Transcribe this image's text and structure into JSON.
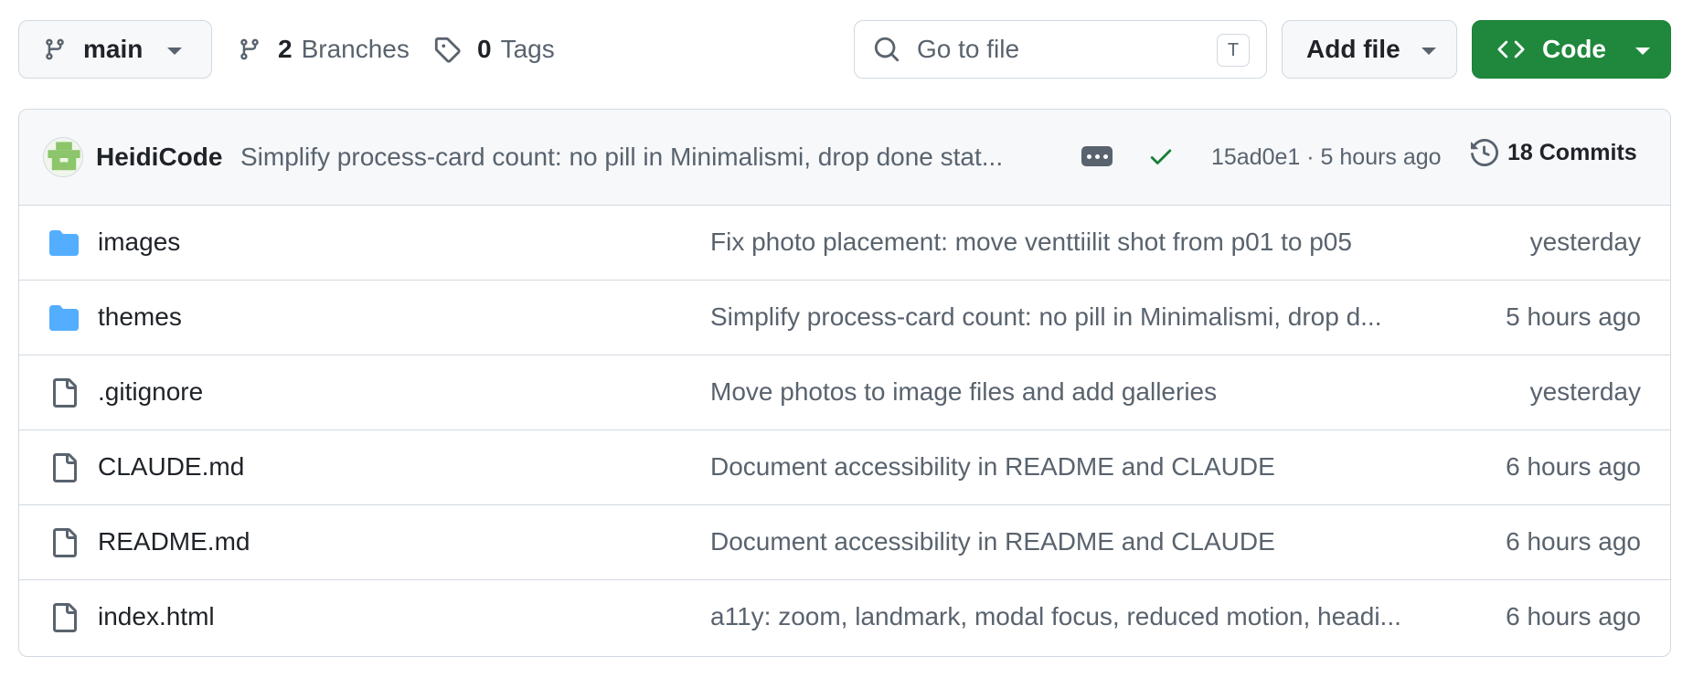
{
  "toolbar": {
    "branch_label": "main",
    "branches_count": "2",
    "branches_label": "Branches",
    "tags_count": "0",
    "tags_label": "Tags",
    "search_placeholder": "Go to file",
    "search_shortcut": "T",
    "add_file_label": "Add file",
    "code_label": "Code"
  },
  "commit": {
    "author": "HeidiCode",
    "message": "Simplify process-card count: no pill in Minimalismi, drop done stat...",
    "sha_time": "15ad0e1 · 5 hours ago",
    "commits_label": "18 Commits",
    "status_color": "#1a7f37"
  },
  "files": [
    {
      "type": "folder",
      "icon": "folder-icon",
      "name": "images",
      "message": "Fix photo placement: move venttiilit shot from p01 to p05",
      "time": "yesterday"
    },
    {
      "type": "folder",
      "icon": "folder-icon",
      "name": "themes",
      "message": "Simplify process-card count: no pill in Minimalismi, drop d...",
      "time": "5 hours ago"
    },
    {
      "type": "file",
      "icon": "file-icon",
      "name": ".gitignore",
      "message": "Move photos to image files and add galleries",
      "time": "yesterday"
    },
    {
      "type": "file",
      "icon": "file-icon",
      "name": "CLAUDE.md",
      "message": "Document accessibility in README and CLAUDE",
      "time": "6 hours ago"
    },
    {
      "type": "file",
      "icon": "file-icon",
      "name": "README.md",
      "message": "Document accessibility in README and CLAUDE",
      "time": "6 hours ago"
    },
    {
      "type": "file",
      "icon": "file-icon",
      "name": "index.html",
      "message": "a11y: zoom, landmark, modal focus, reduced motion, headi...",
      "time": "6 hours ago"
    }
  ],
  "colors": {
    "accent_green": "#1f883d",
    "folder_blue": "#54aeff",
    "muted_text": "#59636e"
  }
}
